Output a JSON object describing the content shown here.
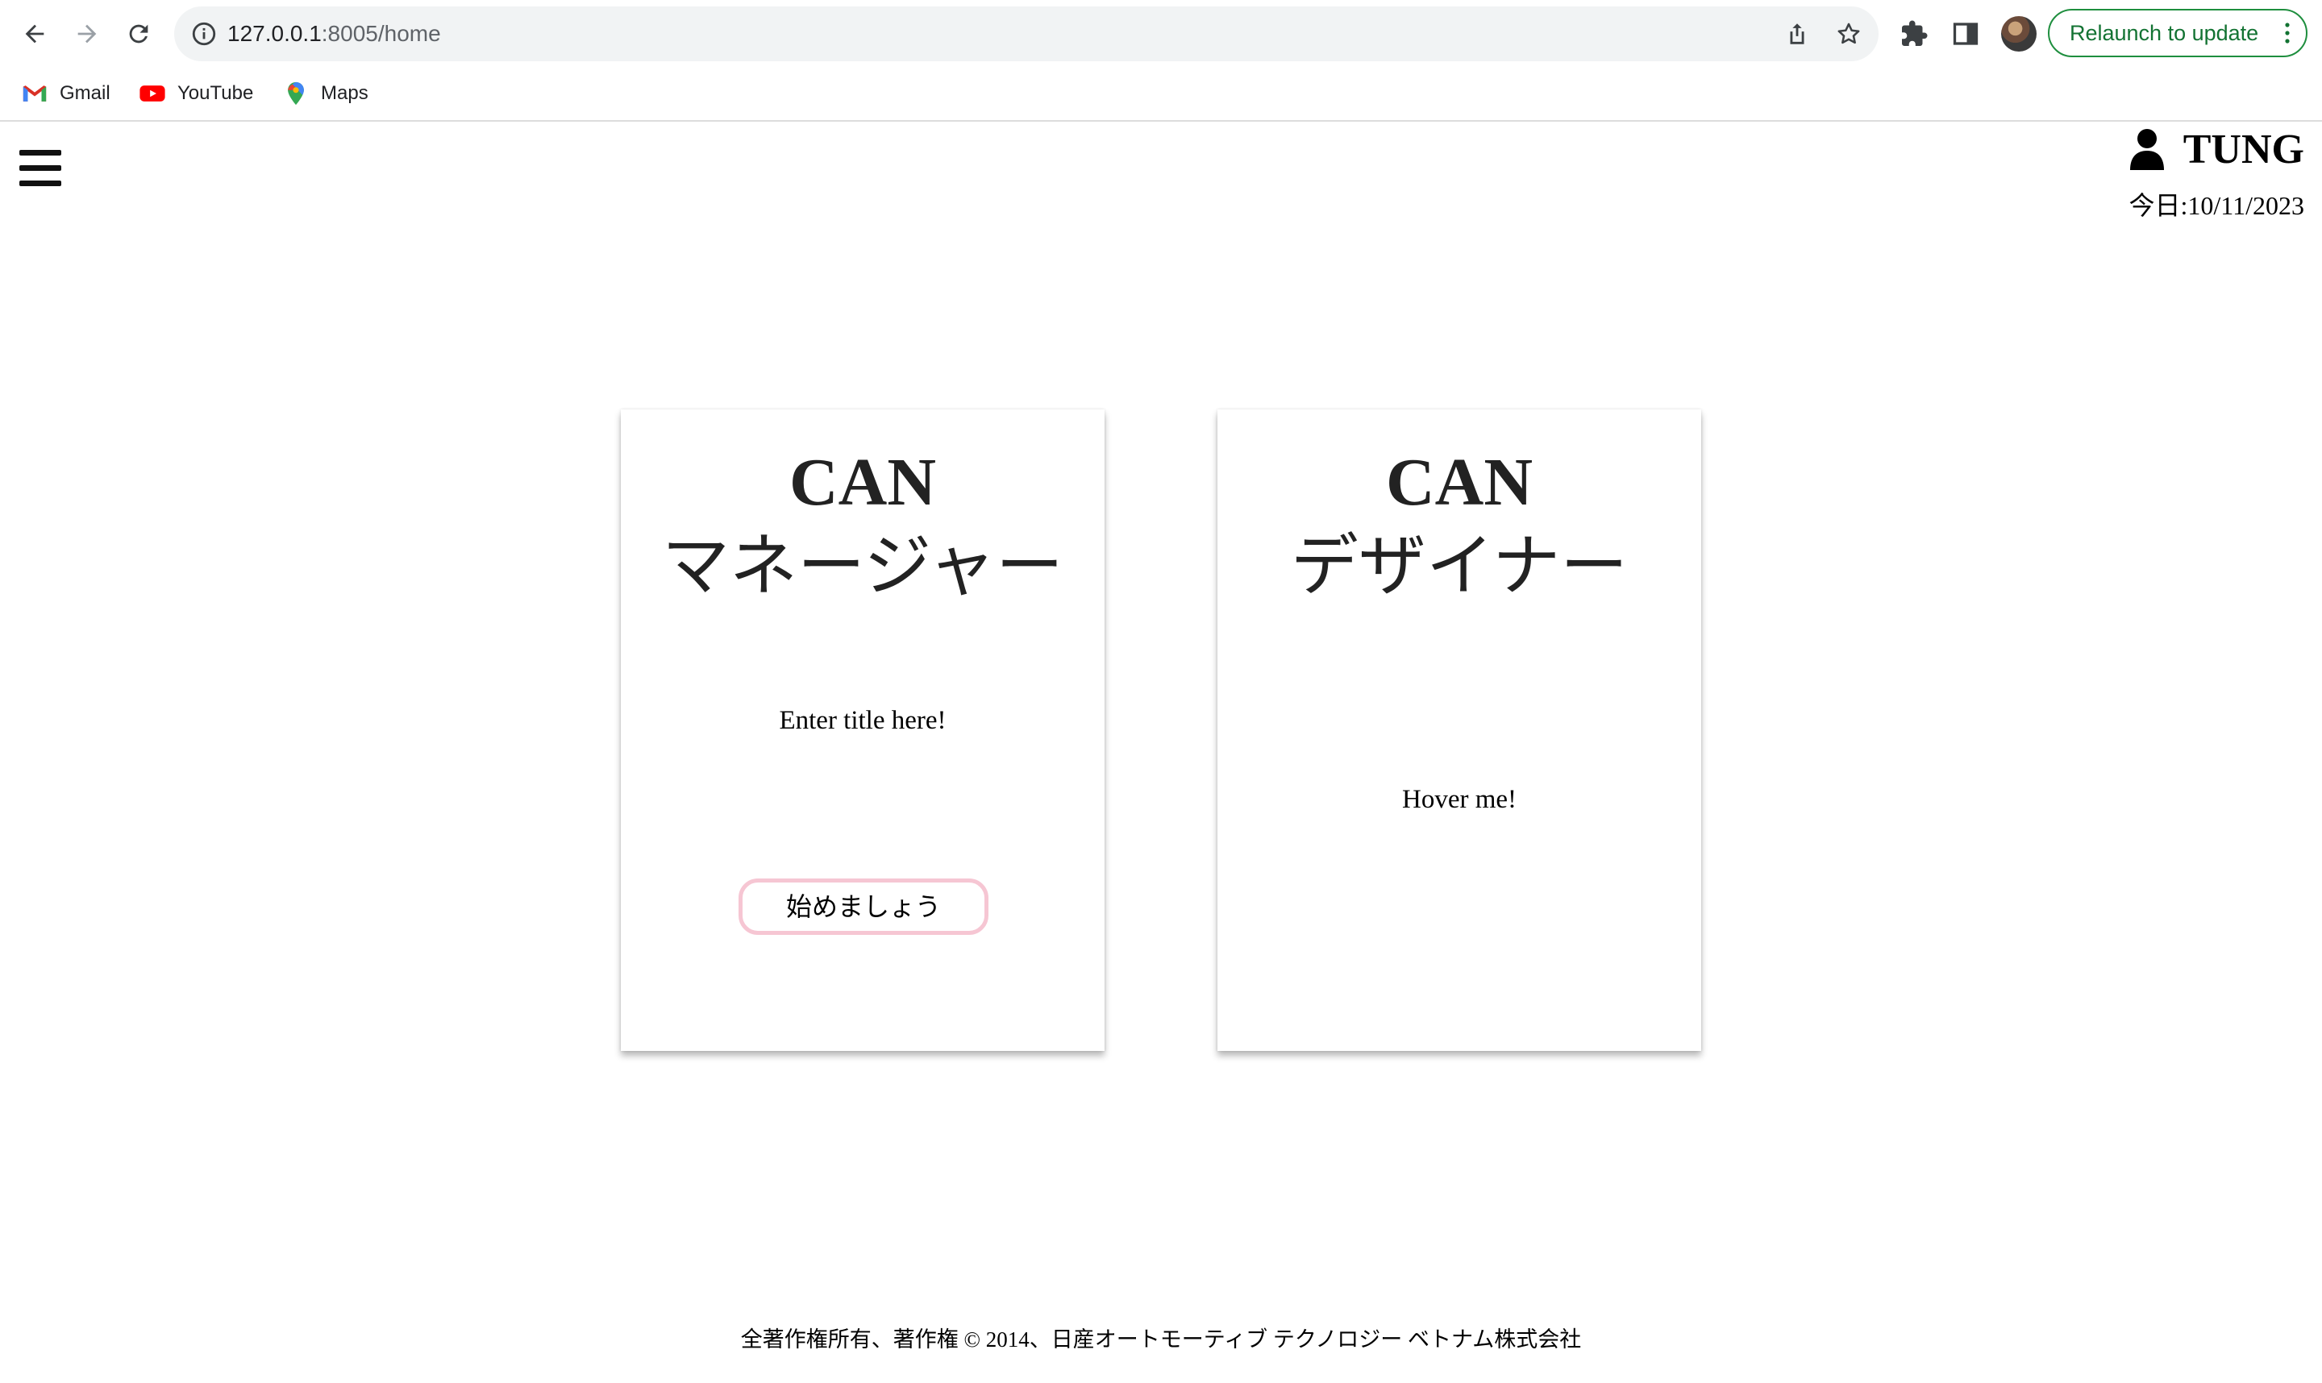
{
  "browser": {
    "url_host": "127.0.0.1",
    "url_rest": ":8005/home",
    "relaunch_label": "Relaunch to update",
    "bookmarks": [
      {
        "label": "Gmail",
        "icon": "gmail-icon"
      },
      {
        "label": "YouTube",
        "icon": "youtube-icon"
      },
      {
        "label": "Maps",
        "icon": "maps-icon"
      }
    ],
    "accent_color": "#1e8e3e"
  },
  "header": {
    "user_name": "TUNG",
    "today": "今日:10/11/2023",
    "user_icon": "user-icon",
    "menu_icon": "hamburger-menu-icon"
  },
  "cards": [
    {
      "title_en": "CAN",
      "title_jp": "マネージャー",
      "text": "Enter title here!",
      "button_label": "始めましょう",
      "button_border_color": "#f6c6d3"
    },
    {
      "title_en": "CAN",
      "title_jp": "デザイナー",
      "text": "Hover me!"
    }
  ],
  "footer": {
    "copyright": "全著作権所有、著作権 © 2014、日産オートモーティブ テクノロジー ベトナム株式会社"
  }
}
